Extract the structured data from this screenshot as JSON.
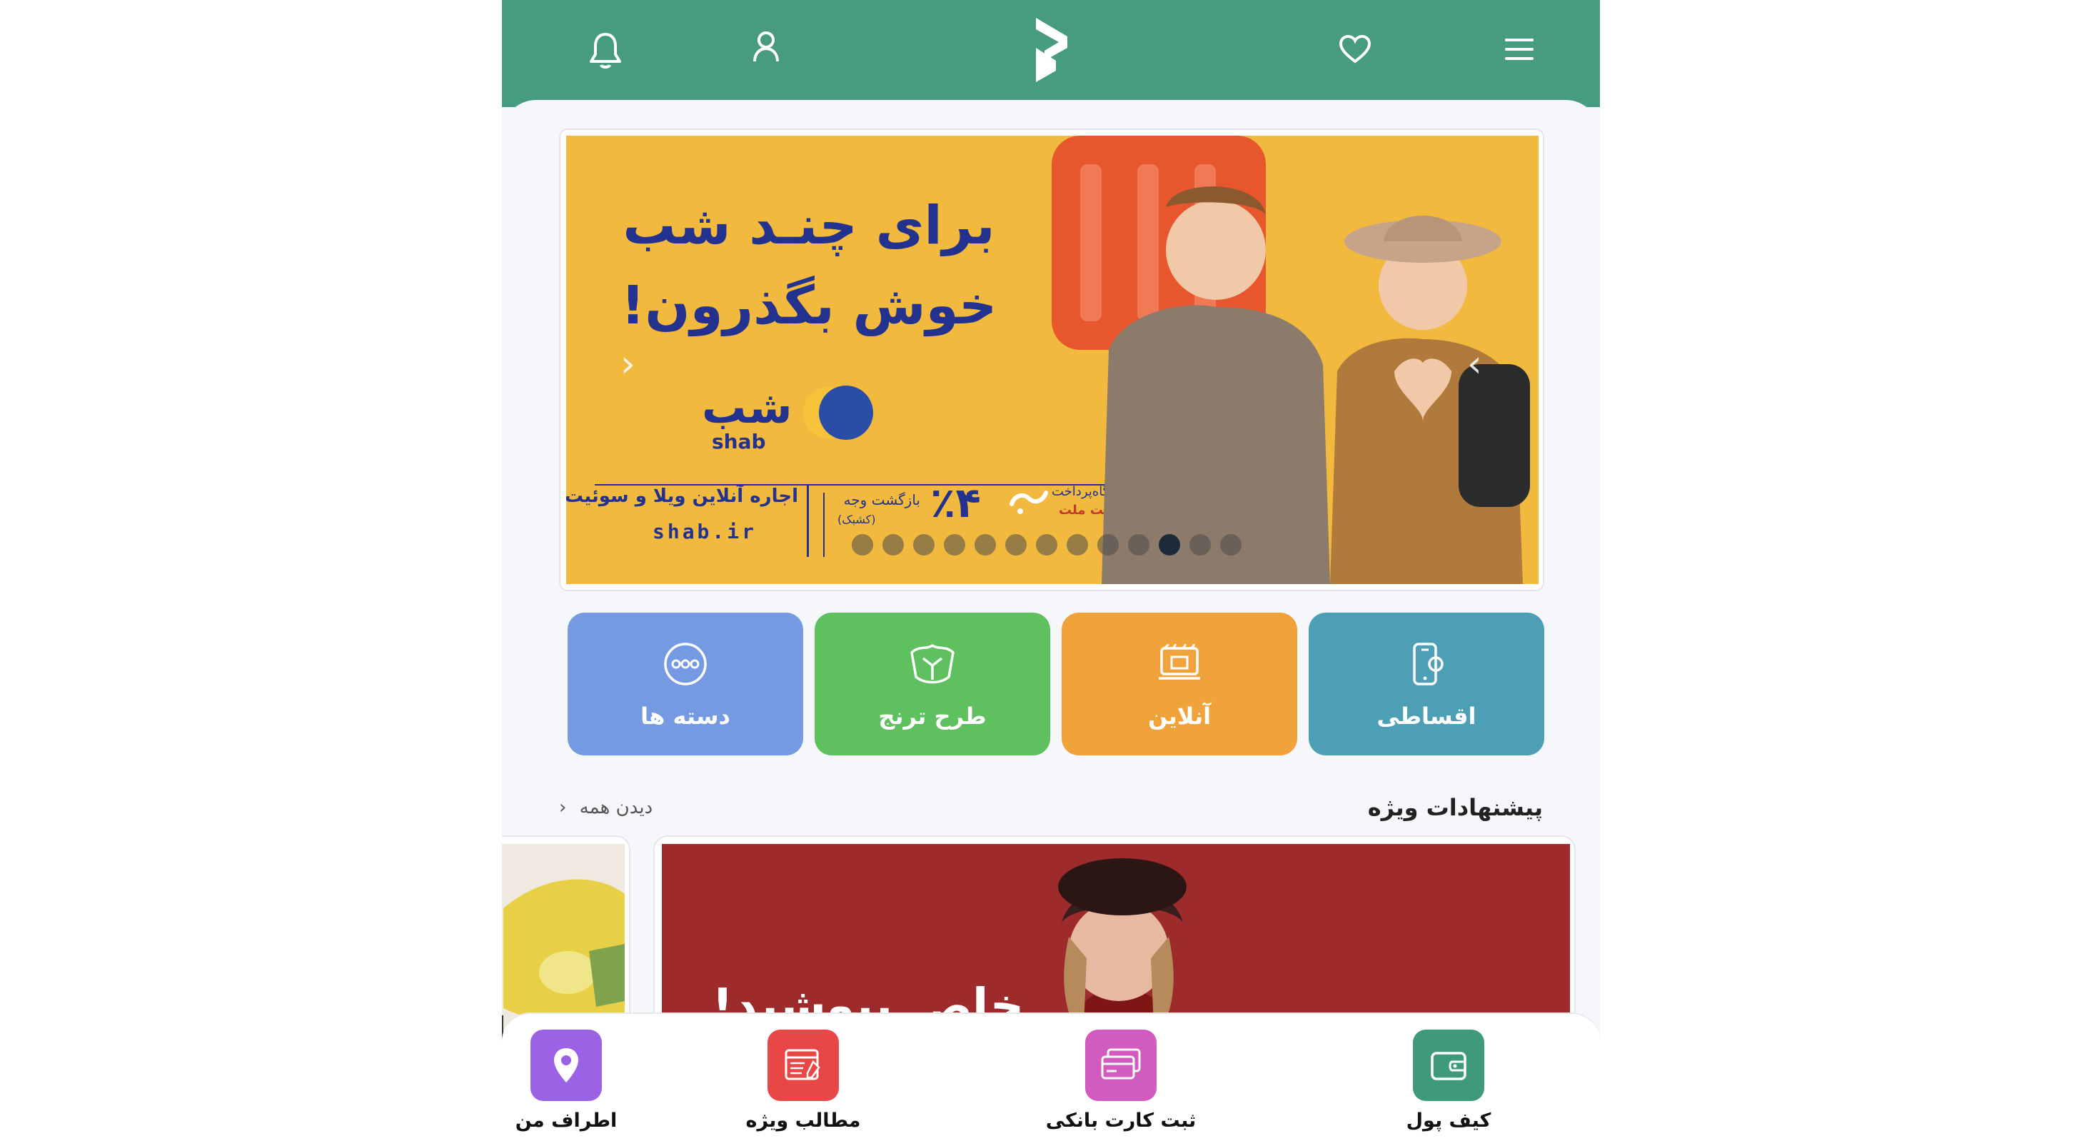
{
  "colors": {
    "header": "#469b80",
    "background": "#f5f7fa",
    "banner": "#f2b93f",
    "banner_text": "#23318f",
    "cat_installments": "#4d9fb6",
    "cat_online": "#f0a33a",
    "cat_toranj": "#5ec05e",
    "cat_categories": "#759ae2",
    "nav_wallet": "#3f9a7d",
    "nav_card": "#d15bbf",
    "nav_articles": "#e84747",
    "nav_nearby": "#9b62e6"
  },
  "header": {
    "icons": [
      "menu-icon",
      "heart-icon",
      "app-logo",
      "user-icon",
      "bell-icon"
    ]
  },
  "banner": {
    "title_line1": "برای چنـد شب",
    "title_line2": "خوش بگذرون!",
    "brand_fa": "شب",
    "brand_en": "shab",
    "promo_title": "اجاره آنلاین ویلا و سوئیت شب",
    "promo_site": "shab.ir",
    "promo_percent": "٪۴",
    "promo_cashback": "بازگشت وجه",
    "promo_cashback_note": "(کشبک)",
    "promo_device": "دستگاه‌پرداخت",
    "promo_mellat": "به‌پرداخت ملت",
    "slides_total": 13,
    "active_slide": 10
  },
  "categories": [
    {
      "label": "اقساطی",
      "icon": "phone-icon"
    },
    {
      "label": "آنلاین",
      "icon": "online-shop-icon"
    },
    {
      "label": "طرح ترنج",
      "icon": "toranj-icon"
    },
    {
      "label": "دسته ها",
      "icon": "more-icon"
    }
  ],
  "special": {
    "title": "پیشنهادات ویژه",
    "see_all": "دیدن همه",
    "card_title": "خاص بپوشید!"
  },
  "bottom_nav": [
    {
      "label": "کیف پول",
      "icon": "wallet-icon"
    },
    {
      "label": "ثبت کارت بانکی",
      "icon": "bank-card-icon"
    },
    {
      "label": "مطالب ویژه",
      "icon": "articles-icon"
    },
    {
      "label": "اطراف من",
      "icon": "location-icon"
    }
  ]
}
